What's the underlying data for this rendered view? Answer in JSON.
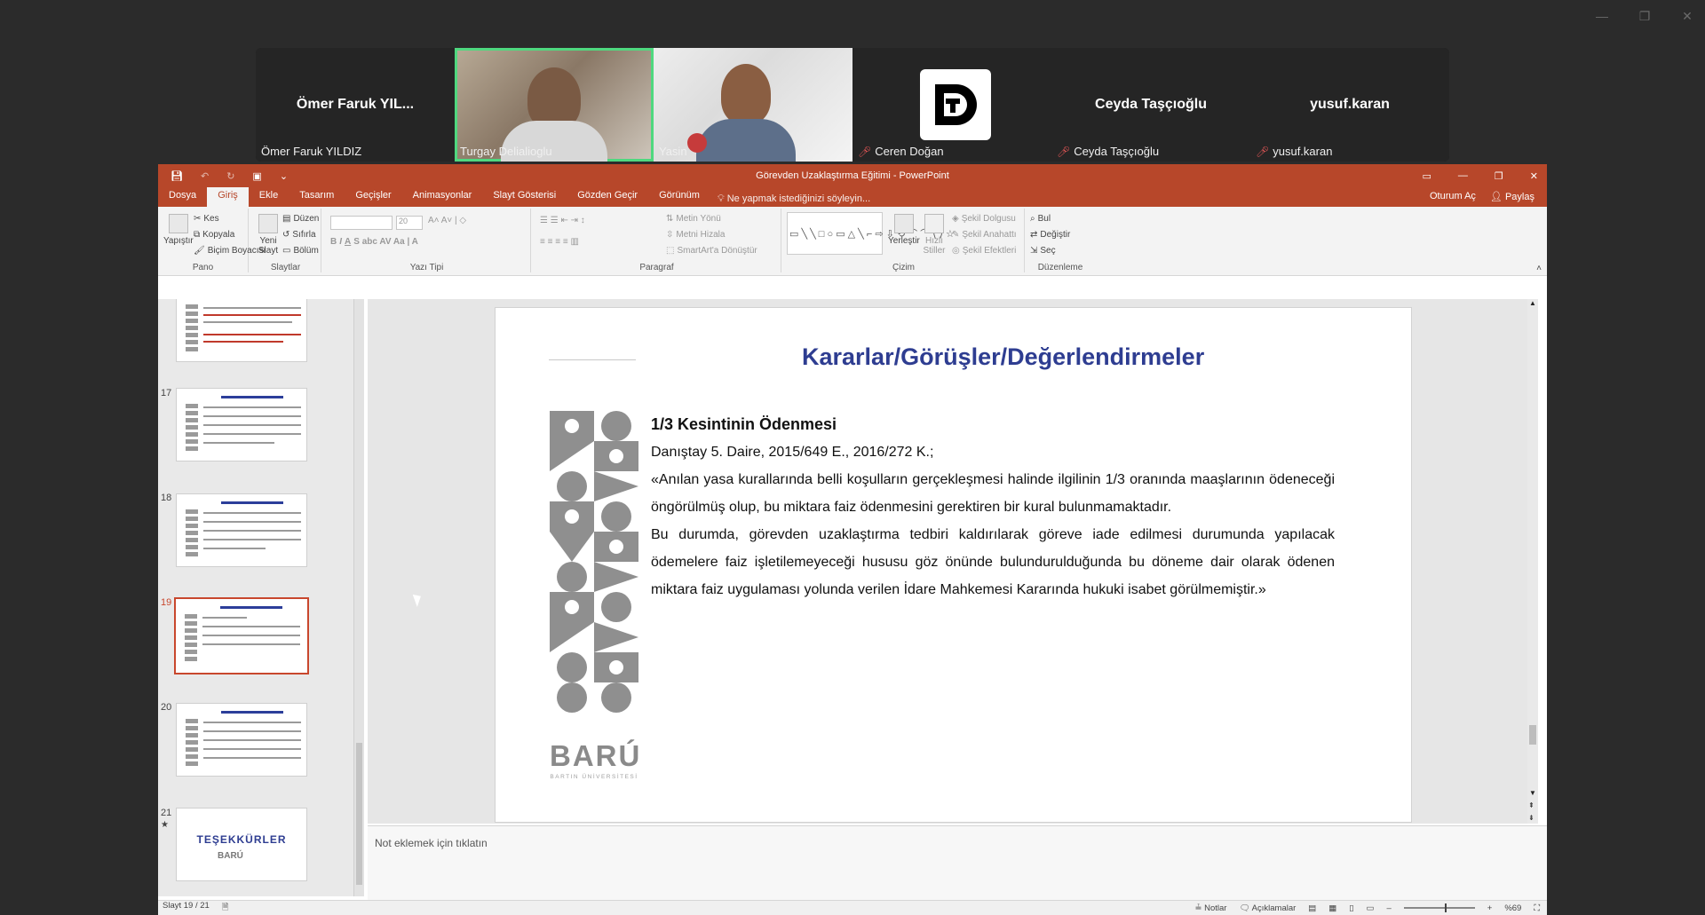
{
  "window_controls": {
    "minimize": "—",
    "restore": "❐",
    "close": "✕"
  },
  "participants": [
    {
      "big_name": "Ömer Faruk YIL...",
      "label": "Ömer Faruk YILDIZ",
      "muted": false,
      "type": "name"
    },
    {
      "big_name": "",
      "label": "Turgay Delialioglu",
      "muted": false,
      "type": "video1"
    },
    {
      "big_name": "",
      "label": "Yasin",
      "muted": false,
      "type": "video2"
    },
    {
      "big_name": "",
      "label": "Ceren Doğan",
      "muted": true,
      "type": "logo"
    },
    {
      "big_name": "Ceyda Taşçıoğlu",
      "label": "Ceyda Taşçıoğlu",
      "muted": true,
      "type": "name"
    },
    {
      "big_name": "yusuf.karan",
      "label": "yusuf.karan",
      "muted": true,
      "type": "name"
    }
  ],
  "ppt": {
    "title": "Görevden Uzaklaştırma Eğitimi - PowerPoint",
    "tabs": [
      "Dosya",
      "Giriş",
      "Ekle",
      "Tasarım",
      "Geçişler",
      "Animasyonlar",
      "Slayt Gösterisi",
      "Gözden Geçir",
      "Görünüm"
    ],
    "tell_me": "Ne yapmak istediğinizi söyleyin...",
    "sign_in": "Oturum Aç",
    "share": "Paylaş",
    "ribbon": {
      "paste": "Yapıştır",
      "cut": "Kes",
      "copy": "Kopyala",
      "format_painter": "Biçim Boyacısı",
      "clipboard_group": "Pano",
      "new_slide": "Yeni Slayt",
      "layout": "Düzen",
      "reset": "Sıfırla",
      "section": "Bölüm",
      "slides_group": "Slaytlar",
      "font_size": "20",
      "font_group": "Yazı Tipi",
      "text_direction": "Metin Yönü",
      "align_text": "Metni Hizala",
      "smartart": "SmartArt'a Dönüştür",
      "paragraph_group": "Paragraf",
      "arrange": "Yerleştir",
      "quick_styles": "Hızlı Stiller",
      "shape_fill": "Şekil Dolgusu",
      "shape_outline": "Şekil Anahattı",
      "shape_effects": "Şekil Efektleri",
      "drawing_group": "Çizim",
      "find": "Bul",
      "replace": "Değiştir",
      "select": "Seç",
      "editing_group": "Düzenleme"
    },
    "thumbnails": [
      {
        "num": "",
        "current": false
      },
      {
        "num": "17",
        "current": false
      },
      {
        "num": "18",
        "current": false
      },
      {
        "num": "19",
        "current": true
      },
      {
        "num": "20",
        "current": false
      },
      {
        "num": "21",
        "current": false,
        "text": "TEŞEKKÜRLER",
        "sub": "BARÚ"
      }
    ],
    "slide": {
      "heading": "Kararlar/Görüşler/Değerlendirmeler",
      "subheading": "1/3 Kesintinin Ödenmesi",
      "reference": "Danıştay 5. Daire, 2015/649 E., 2016/272 K.;",
      "paragraph1": "«Anılan yasa kurallarında belli koşulların gerçekleşmesi halinde ilgilinin 1/3 oranında maaşlarının ödeneceği öngörülmüş olup, bu miktara faiz ödenmesini gerektiren bir kural bulunmamaktadır.",
      "paragraph2": "Bu durumda, görevden uzaklaştırma tedbiri kaldırılarak göreve iade edilmesi durumunda yapılacak ödemelere faiz işletilemeyeceği hususu göz önünde bulundurulduğunda bu döneme dair olarak ödenen  miktara faiz uygulaması yolunda verilen İdare Mahkemesi Kararında hukuki isabet görülmemiştir.»",
      "logo_word": "BARÚ",
      "logo_sub": "BARTIN ÜNİVERSİTESİ"
    },
    "notes_placeholder": "Not eklemek için tıklatın",
    "status": {
      "slide_info": "Slayt 19 / 21",
      "notes": "Notlar",
      "comments": "Açıklamalar",
      "zoom": "%69"
    }
  }
}
